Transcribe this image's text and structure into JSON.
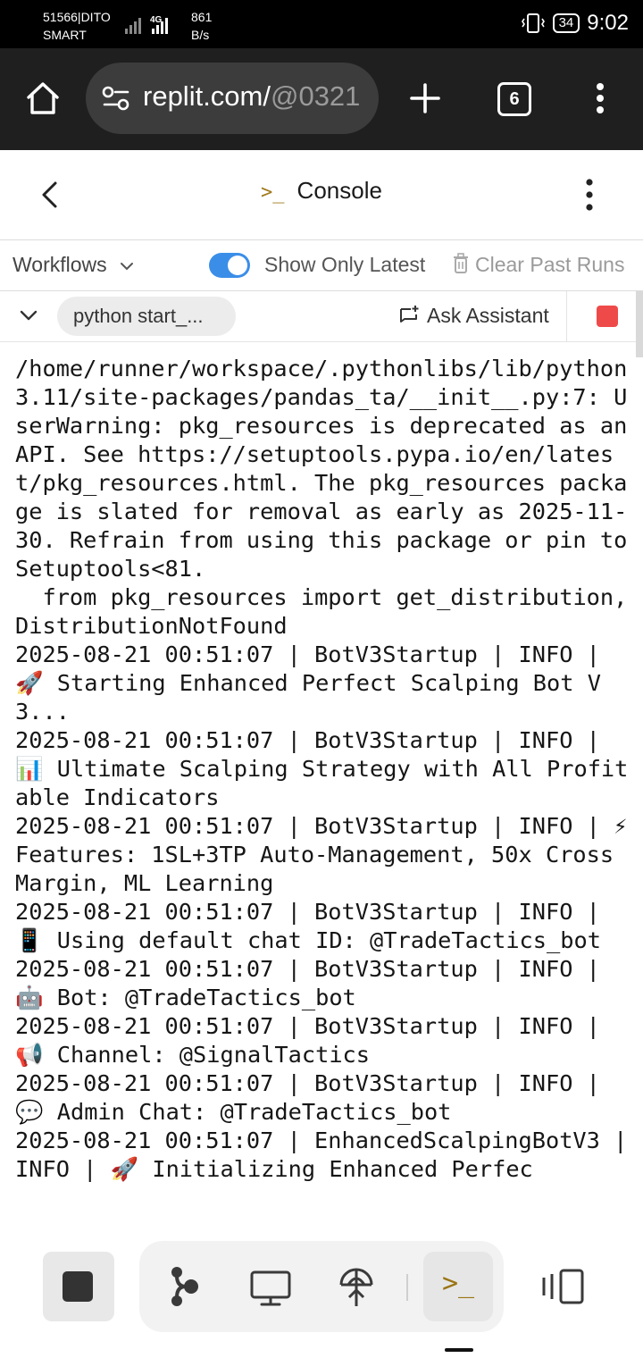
{
  "status_bar": {
    "carrier_line1": "51566|DITO",
    "carrier_line2": "SMART",
    "network": "4G",
    "speed_value": "861",
    "speed_unit": "B/s",
    "battery": "34",
    "time": "9:02"
  },
  "browser": {
    "url_main": "replit.com/",
    "url_rest": "@0321",
    "tab_count": "6"
  },
  "header": {
    "title_glyph": ">_",
    "title": "Console"
  },
  "toolbar": {
    "workflows_label": "Workflows",
    "show_only_latest_label": "Show Only Latest",
    "show_only_latest_on": true,
    "clear_past_runs_label": "Clear Past Runs"
  },
  "run_bar": {
    "workflow_name": "python start_...",
    "ask_assistant_label": "Ask Assistant",
    "stop_color": "#ef4a4a"
  },
  "console": {
    "output": "/home/runner/workspace/.pythonlibs/lib/python3.11/site-packages/pandas_ta/__init__.py:7: UserWarning: pkg_resources is deprecated as an API. See https://setuptools.pypa.io/en/latest/pkg_resources.html. The pkg_resources package is slated for removal as early as 2025-11-30. Refrain from using this package or pin to Setuptools<81.\n  from pkg_resources import get_distribution, DistributionNotFound\n2025-08-21 00:51:07 | BotV3Startup | INFO | 🚀 Starting Enhanced Perfect Scalping Bot V3...\n2025-08-21 00:51:07 | BotV3Startup | INFO | 📊 Ultimate Scalping Strategy with All Profitable Indicators\n2025-08-21 00:51:07 | BotV3Startup | INFO | ⚡ Features: 1SL+3TP Auto-Management, 50x Cross Margin, ML Learning\n2025-08-21 00:51:07 | BotV3Startup | INFO | 📱 Using default chat ID: @TradeTactics_bot\n2025-08-21 00:51:07 | BotV3Startup | INFO | 🤖 Bot: @TradeTactics_bot\n2025-08-21 00:51:07 | BotV3Startup | INFO | 📢 Channel: @SignalTactics\n2025-08-21 00:51:07 | BotV3Startup | INFO | 💬 Admin Chat: @TradeTactics_bot\n2025-08-21 00:51:07 | EnhancedScalpingBotV3 | INFO | 🚀 Initializing Enhanced Perfec"
  },
  "bottom_bar": {
    "items": [
      "stop-icon",
      "git-icon",
      "preview-icon",
      "deploy-icon",
      "console-icon",
      "tabs-icon"
    ],
    "console_glyph": ">_"
  },
  "colors": {
    "accent_blue": "#3b8ee8",
    "stop_red": "#ef4a4a",
    "prompt_gold": "#a07a1c"
  }
}
